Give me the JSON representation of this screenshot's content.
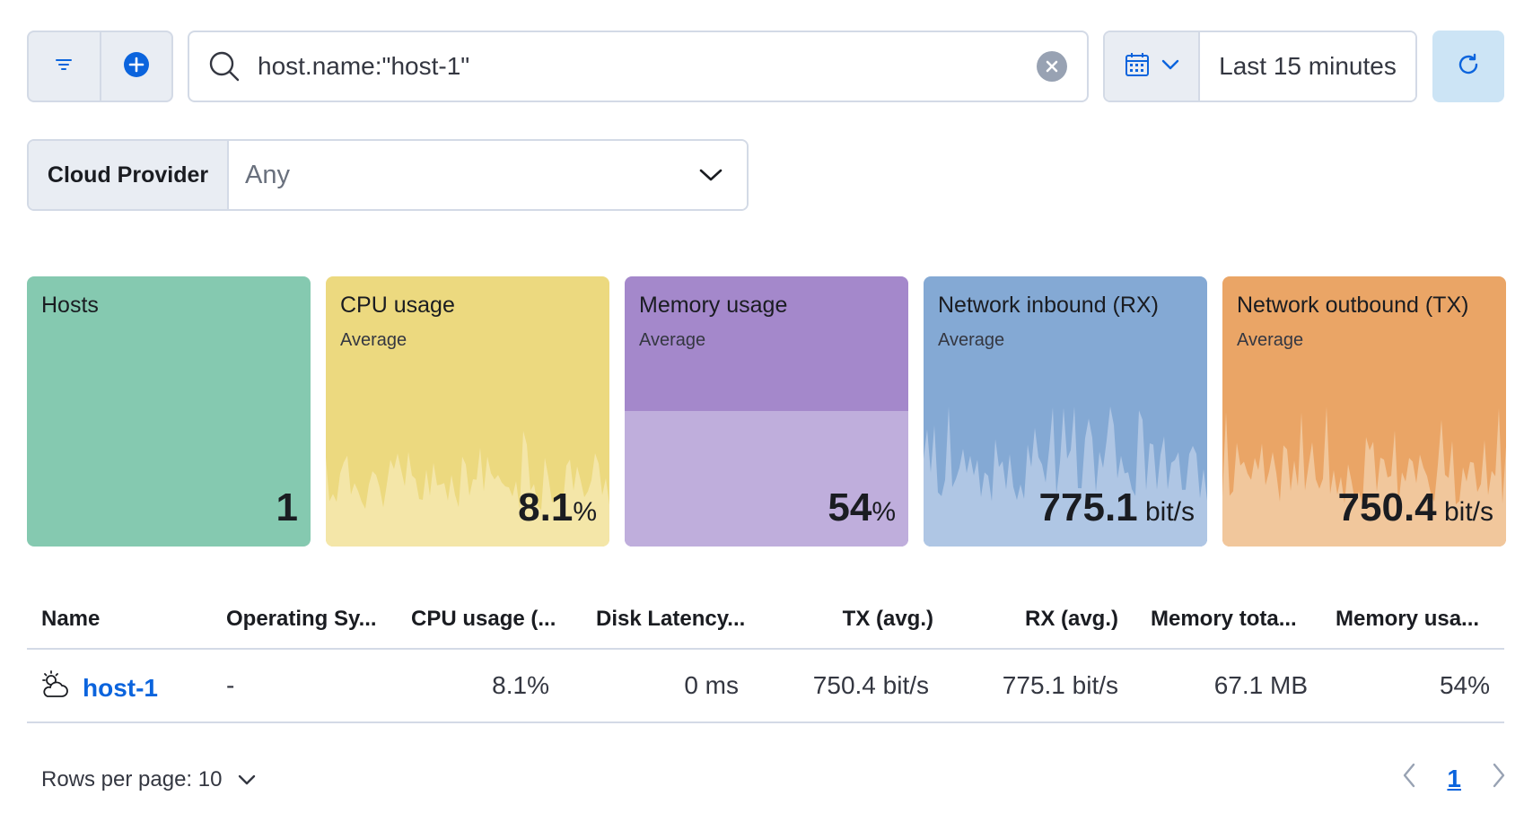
{
  "toolbar": {
    "filter_icon": "filter-icon",
    "add_icon": "plus-circle-icon",
    "search_icon": "search-icon",
    "query": "host.name:\"host-1\"",
    "clear_icon": "clear-icon",
    "calendar_icon": "calendar-icon",
    "time_range": "Last 15 minutes",
    "refresh_icon": "refresh-icon"
  },
  "control": {
    "label": "Cloud Provider",
    "value": "Any"
  },
  "cards": [
    {
      "title": "Hosts",
      "subtitle": "",
      "value": "1",
      "unit": "",
      "color": "#85c9b0"
    },
    {
      "title": "CPU usage",
      "subtitle": "Average",
      "value": "8.1",
      "unit": "%",
      "color": "#ecd97f"
    },
    {
      "title": "Memory usage",
      "subtitle": "Average",
      "value": "54",
      "unit": "%",
      "color": "#a488cb"
    },
    {
      "title": "Network inbound (RX)",
      "subtitle": "Average",
      "value": "775.1",
      "unit": " bit/s",
      "color": "#84a9d4"
    },
    {
      "title": "Network outbound (TX)",
      "subtitle": "Average",
      "value": "750.4",
      "unit": " bit/s",
      "color": "#eaa566"
    }
  ],
  "table": {
    "headers": [
      "Name",
      "Operating Sy...",
      "CPU usage (...",
      "Disk Latency...",
      "TX (avg.)",
      "RX (avg.)",
      "Memory tota...",
      "Memory usa..."
    ],
    "rows": [
      {
        "name": "host-1",
        "os": "-",
        "cpu": "8.1%",
        "disk": "0 ms",
        "tx": "750.4 bit/s",
        "rx": "775.1 bit/s",
        "mem_total": "67.1 MB",
        "mem_usage": "54%"
      }
    ]
  },
  "pagination": {
    "rows_per_page": "Rows per page: 10",
    "current_page": "1"
  }
}
